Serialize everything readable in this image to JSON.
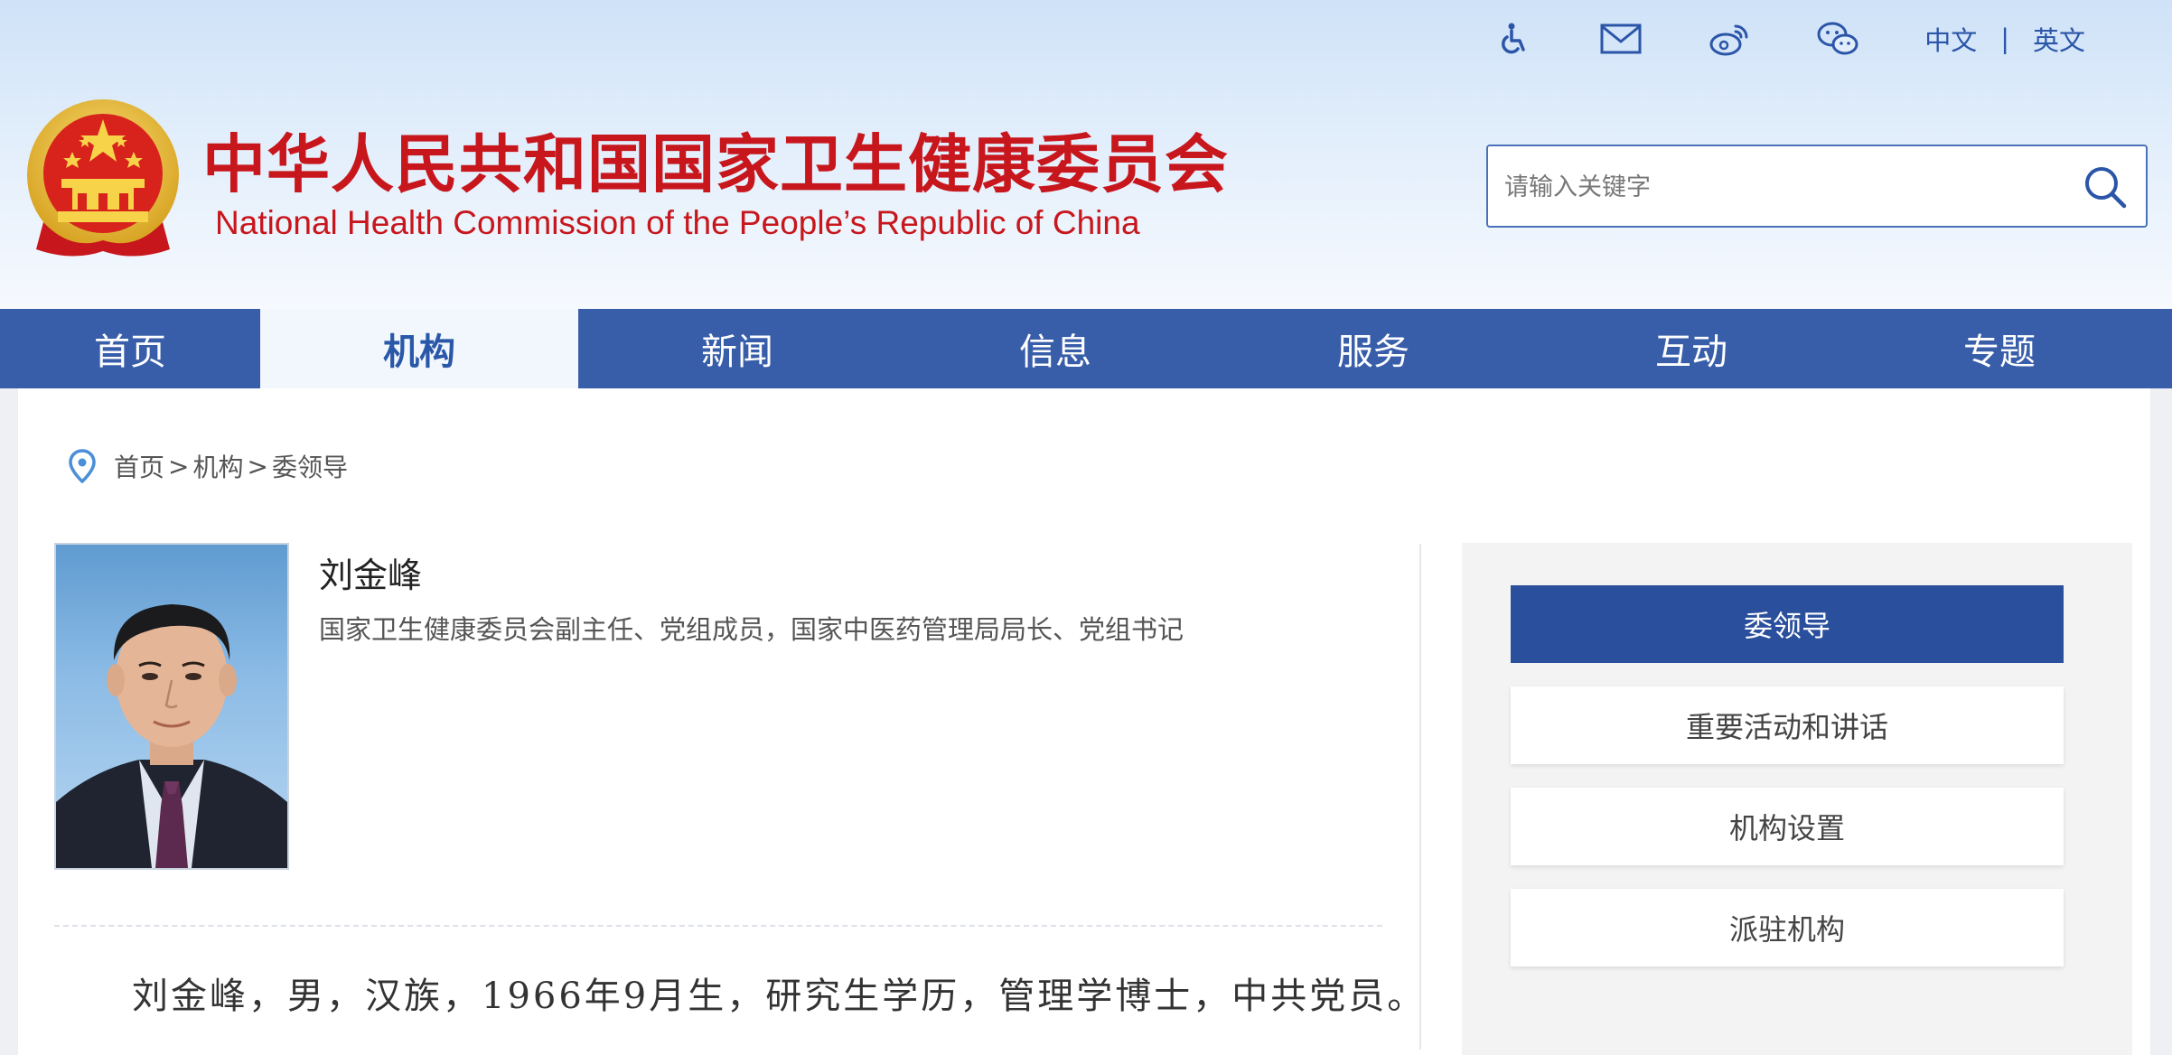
{
  "topbar": {
    "icons": [
      "accessibility-icon",
      "mail-icon",
      "weibo-icon",
      "wechat-icon"
    ],
    "lang_cn": "中文",
    "lang_sep": "|",
    "lang_en": "英文"
  },
  "header": {
    "title_cn": "中华人民共和国国家卫生健康委员会",
    "title_en": "National Health Commission of the People’s  Republic of China",
    "search_placeholder": "请输入关键字"
  },
  "nav": {
    "items": [
      {
        "label": "首页",
        "active": false
      },
      {
        "label": "机构",
        "active": true
      },
      {
        "label": "新闻",
        "active": false
      },
      {
        "label": "信息",
        "active": false
      },
      {
        "label": "服务",
        "active": false
      },
      {
        "label": "互动",
        "active": false
      },
      {
        "label": "专题",
        "active": false
      }
    ]
  },
  "breadcrumb": {
    "items": [
      "首页",
      "机构",
      "委领导"
    ],
    "separator": ">"
  },
  "profile": {
    "name": "刘金峰",
    "position": "国家卫生健康委员会副主任、党组成员，国家中医药管理局局长、党组书记",
    "bio": "刘金峰，男，汉族，1966年9月生，研究生学历，管理学博士，中共党员。"
  },
  "sidebar": {
    "items": [
      {
        "label": "委领导",
        "active": true
      },
      {
        "label": "重要活动和讲话",
        "active": false
      },
      {
        "label": "机构设置",
        "active": false
      },
      {
        "label": "派驻机构",
        "active": false
      }
    ]
  },
  "colors": {
    "nav_bg": "#385eaa",
    "title_red": "#c8161d",
    "active_side": "#2a4f9c",
    "link_blue": "#2b55a8"
  }
}
